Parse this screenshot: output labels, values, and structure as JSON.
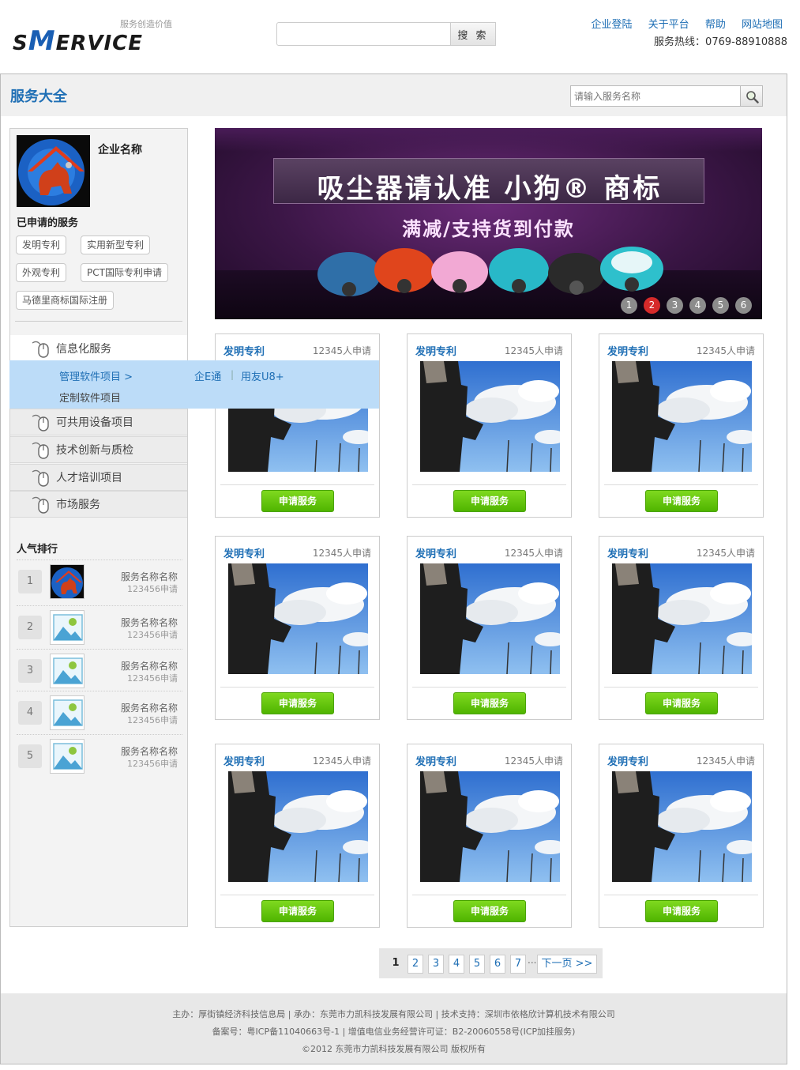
{
  "header": {
    "logo_text": "SMERVICE",
    "slogan": "服务创造价值",
    "search_button": "搜 索",
    "links": [
      "企业登陆",
      "关于平台",
      "帮助",
      "网站地图"
    ],
    "hotline": "服务热线：0769-88910888"
  },
  "page": {
    "title": "服务大全",
    "search_placeholder": "请输入服务名称"
  },
  "sidebar": {
    "company_name": "企业名称",
    "applied_title": "已申请的服务",
    "tags": [
      "发明专利",
      "实用新型专利",
      "外观专利",
      "PCT国际专利申请",
      "马德里商标国际注册"
    ],
    "menu": [
      "信息化服务",
      "可共用设备项目",
      "技术创新与质检",
      "人才培训项目",
      "市场服务"
    ],
    "submenu": {
      "item1": "管理软件项目 >",
      "item2": "定制软件项目",
      "links": [
        "企E通",
        "用友U8+"
      ],
      "separator": "|"
    },
    "popular_title": "人气排行",
    "popular": [
      {
        "rank": "1",
        "name": "服务名称名称",
        "count": "123456申请"
      },
      {
        "rank": "2",
        "name": "服务名称名称",
        "count": "123456申请"
      },
      {
        "rank": "3",
        "name": "服务名称名称",
        "count": "123456申请"
      },
      {
        "rank": "4",
        "name": "服务名称名称",
        "count": "123456申请"
      },
      {
        "rank": "5",
        "name": "服务名称名称",
        "count": "123456申请"
      }
    ]
  },
  "banner": {
    "headline": "吸尘器请认准 小狗® 商标",
    "subline": "满减/支持货到付款",
    "dots": [
      "1",
      "2",
      "3",
      "4",
      "5",
      "6"
    ],
    "active_dot": "2"
  },
  "products": [
    {
      "category": "发明专利",
      "count": "12345人申请",
      "button": "申请服务"
    },
    {
      "category": "发明专利",
      "count": "12345人申请",
      "button": "申请服务"
    },
    {
      "category": "发明专利",
      "count": "12345人申请",
      "button": "申请服务"
    },
    {
      "category": "发明专利",
      "count": "12345人申请",
      "button": "申请服务"
    },
    {
      "category": "发明专利",
      "count": "12345人申请",
      "button": "申请服务"
    },
    {
      "category": "发明专利",
      "count": "12345人申请",
      "button": "申请服务"
    },
    {
      "category": "发明专利",
      "count": "12345人申请",
      "button": "申请服务"
    },
    {
      "category": "发明专利",
      "count": "12345人申请",
      "button": "申请服务"
    },
    {
      "category": "发明专利",
      "count": "12345人申请",
      "button": "申请服务"
    }
  ],
  "pagination": {
    "pages": [
      "1",
      "2",
      "3",
      "4",
      "5",
      "6",
      "7"
    ],
    "current": "1",
    "ellipsis": "...",
    "next": "下一页 >>"
  },
  "footer": {
    "line1": "主办：厚街镇经济科技信息局 | 承办：东莞市力凯科技发展有限公司 | 技术支持：深圳市依格欣计算机技术有限公司",
    "line2": "备案号：粤ICP备11040663号-1 | 增值电信业务经营许可证：B2-20060558号(ICP加挂服务)",
    "line3": "©2012 东莞市力凯科技发展有限公司 版权所有"
  },
  "colors": {
    "accent": "#1f6fb5",
    "apply_green": "#5cc00a",
    "flyout": "#bcdcf8",
    "active_dot": "#d62a2a"
  }
}
